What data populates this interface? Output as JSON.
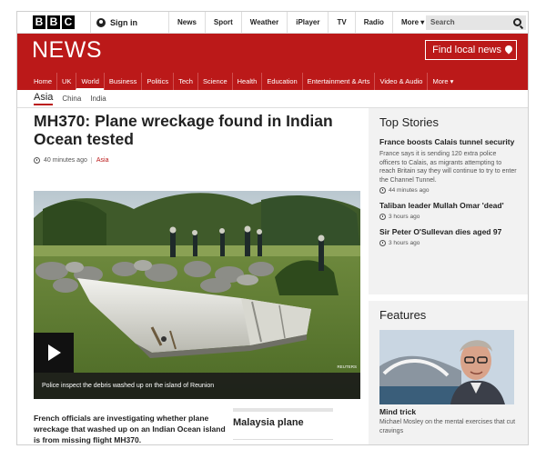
{
  "top_bar": {
    "logo_letters": [
      "B",
      "B",
      "C"
    ],
    "sign_in": "Sign in",
    "nav": [
      "News",
      "Sport",
      "Weather",
      "iPlayer",
      "TV",
      "Radio",
      "More"
    ],
    "search_placeholder": "Search"
  },
  "masthead": {
    "title": "NEWS",
    "local_button": "Find local news",
    "brand_color": "#bb1919"
  },
  "section_nav": [
    "Home",
    "UK",
    "World",
    "Business",
    "Politics",
    "Tech",
    "Science",
    "Health",
    "Education",
    "Entertainment & Arts",
    "Video & Audio",
    "More"
  ],
  "active_section": "World",
  "sub_nav": {
    "current": "Asia",
    "items": [
      "China",
      "India"
    ]
  },
  "article": {
    "headline": "MH370: Plane wreckage found in Indian Ocean tested",
    "time": "40 minutes ago",
    "tag": "Asia",
    "photo_caption": "Police inspect the debris washed up on the island of Reunion",
    "photo_credit": "REUTERS",
    "summary": "French officials are investigating whether plane wreckage that washed up on an Indian Ocean island is from missing flight MH370.",
    "related_title": "Malaysia plane"
  },
  "top_stories": {
    "title": "Top Stories",
    "items": [
      {
        "headline": "France boosts Calais tunnel security",
        "body": "France says it is sending 120 extra police officers to Calais, as migrants attempting to reach Britain say they will continue to try to enter the Channel Tunnel.",
        "time": "44 minutes ago"
      },
      {
        "headline": "Taliban leader Mullah Omar 'dead'",
        "time": "3 hours ago"
      },
      {
        "headline": "Sir Peter O'Sullevan dies aged 97",
        "time": "3 hours ago"
      }
    ]
  },
  "features": {
    "title": "Features",
    "headline": "Mind trick",
    "body": "Michael Mosley on the mental exercises that cut cravings"
  }
}
